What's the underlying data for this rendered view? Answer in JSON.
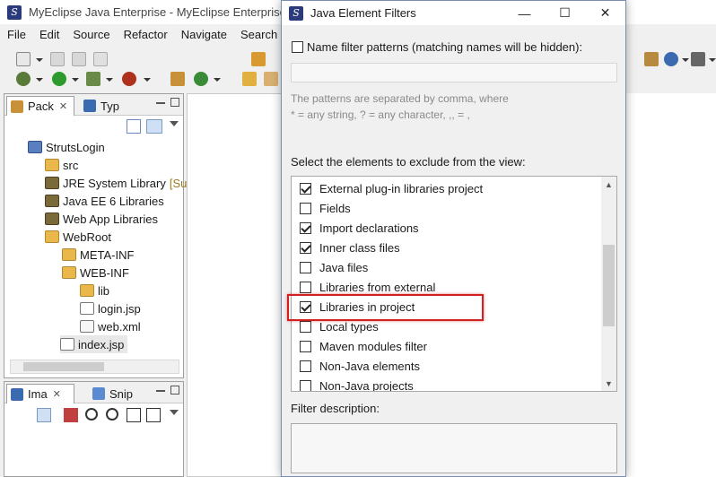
{
  "ide": {
    "title": "MyEclipse Java Enterprise - MyEclipse Enterprise",
    "menu": [
      "File",
      "Edit",
      "Source",
      "Refactor",
      "Navigate",
      "Search"
    ],
    "package_view": {
      "tabs": [
        {
          "label": "Pack"
        },
        {
          "label": "Typ"
        }
      ],
      "tree": [
        {
          "label": "StrutsLogin",
          "icon": "project-icon"
        },
        {
          "label": "src",
          "icon": "folder-icon"
        },
        {
          "label": "JRE System Library",
          "suffix": "[Su",
          "icon": "library-icon"
        },
        {
          "label": "Java EE 6 Libraries",
          "icon": "library-icon"
        },
        {
          "label": "Web App Libraries",
          "icon": "library-icon"
        },
        {
          "label": "WebRoot",
          "icon": "folder-icon"
        },
        {
          "label": "META-INF",
          "icon": "folder-icon"
        },
        {
          "label": "WEB-INF",
          "icon": "folder-icon"
        },
        {
          "label": "lib",
          "icon": "folder-icon"
        },
        {
          "label": "login.jsp",
          "icon": "jsp-file-icon"
        },
        {
          "label": "web.xml",
          "icon": "xml-file-icon"
        },
        {
          "label": "index.jsp",
          "icon": "jsp-file-icon"
        }
      ]
    },
    "bottom_view": {
      "tabs": [
        {
          "label": "Ima"
        },
        {
          "label": "Snip"
        }
      ]
    }
  },
  "dialog": {
    "title": "Java Element Filters",
    "name_filter_label": "Name filter patterns (matching names will be hidden):",
    "name_filter_checked": false,
    "pattern_value": "",
    "hint_line1": "The patterns are separated by comma, where",
    "hint_line2": "* = any string, ? = any character, ,, = ,",
    "select_label": "Select the elements to exclude from the view:",
    "items": [
      {
        "label": "External plug-in libraries project",
        "checked": true
      },
      {
        "label": "Fields",
        "checked": false
      },
      {
        "label": "Import declarations",
        "checked": true
      },
      {
        "label": "Inner class files",
        "checked": true
      },
      {
        "label": "Java files",
        "checked": false
      },
      {
        "label": "Libraries from external",
        "checked": false
      },
      {
        "label": "Libraries in project",
        "checked": true
      },
      {
        "label": "Local types",
        "checked": false
      },
      {
        "label": "Maven modules filter",
        "checked": false
      },
      {
        "label": "Non-Java elements",
        "checked": false
      },
      {
        "label": "Non-Java projects",
        "checked": false
      }
    ],
    "description_label": "Filter description:",
    "description_value": ""
  },
  "colors": {
    "highlight": "#d02020",
    "dialog_border": "#7a8fb0"
  }
}
